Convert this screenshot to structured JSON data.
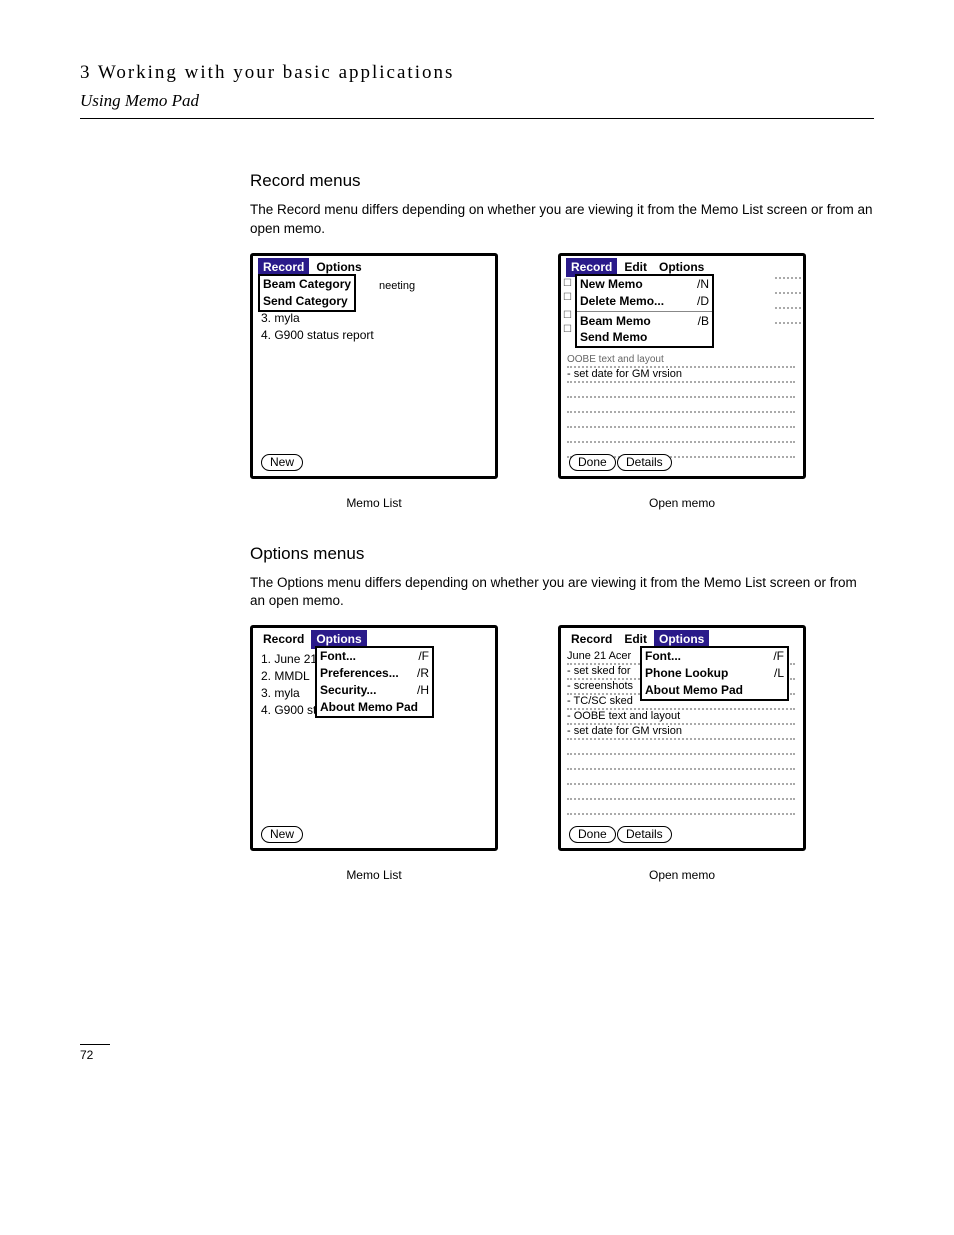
{
  "header": {
    "chapter": "3 Working with your basic applications",
    "section": "Using Memo Pad"
  },
  "sec1": {
    "title": "Record menus",
    "para": "The Record menu differs depending on whether you are viewing it from the Memo List screen or from an open memo."
  },
  "sec2": {
    "title": "Options menus",
    "para": "The Options menu differs depending on whether you are viewing it from the Memo List screen or from an open memo."
  },
  "captions": {
    "memoList": "Memo List",
    "openMemo": "Open memo"
  },
  "fig1a": {
    "menus": [
      "Record",
      "Options"
    ],
    "activeIdx": 0,
    "dropdown": [
      {
        "label": "Beam Category",
        "shortcut": ""
      },
      {
        "label": "Send Category",
        "shortcut": ""
      }
    ],
    "bg_items": [
      "neeting",
      "3.  myla",
      "4.  G900 status report"
    ],
    "buttons": [
      "New"
    ]
  },
  "fig1b": {
    "menus": [
      "Record",
      "Edit",
      "Options"
    ],
    "activeIdx": 0,
    "dropdown": [
      {
        "label": "New Memo",
        "shortcut": "/N"
      },
      {
        "label": "Delete Memo...",
        "shortcut": "/D"
      },
      {
        "sep": true
      },
      {
        "label": "Beam Memo",
        "shortcut": "/B"
      },
      {
        "label": "Send Memo",
        "shortcut": ""
      }
    ],
    "bg_lines": [
      "OOBE text and layout",
      "set date for GM vrsion"
    ],
    "buttons": [
      "Done",
      "Details"
    ]
  },
  "fig2a": {
    "menus": [
      "Record",
      "Options"
    ],
    "activeIdx": 1,
    "dropdown": [
      {
        "label": "Font...",
        "shortcut": "/F"
      },
      {
        "label": "Preferences...",
        "shortcut": "/R"
      },
      {
        "label": "Security...",
        "shortcut": "/H"
      },
      {
        "label": "About Memo Pad",
        "shortcut": ""
      }
    ],
    "bg_items": [
      "1.  June 21",
      "2.  MMDL",
      "3.  myla",
      "4.  G900 st"
    ],
    "buttons": [
      "New"
    ]
  },
  "fig2b": {
    "menus": [
      "Record",
      "Edit",
      "Options"
    ],
    "activeIdx": 2,
    "dropdown": [
      {
        "label": "Font...",
        "shortcut": "/F"
      },
      {
        "label": "Phone Lookup",
        "shortcut": "/L"
      },
      {
        "label": "About Memo Pad",
        "shortcut": ""
      }
    ],
    "bg_lines": [
      "June 21 Acer",
      "set sked for",
      "screenshots",
      "TC/SC sked",
      "OOBE text and layout",
      "set date for GM vrsion"
    ],
    "buttons": [
      "Done",
      "Details"
    ]
  },
  "pageNumber": "72"
}
